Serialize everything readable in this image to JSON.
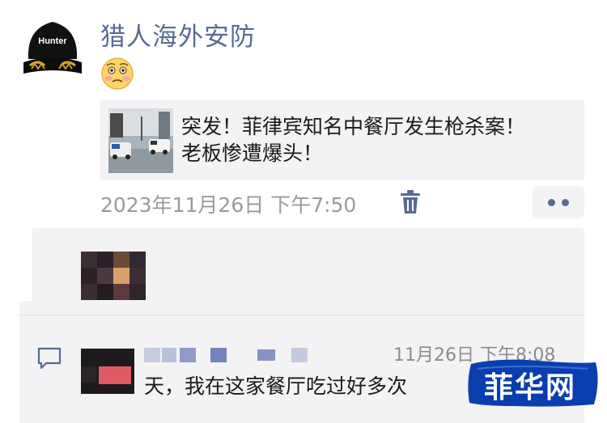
{
  "post": {
    "poster_name": "猎人海外安防",
    "avatar_text": "Hunter",
    "emoji": "woozy-face-emoji",
    "shared_article": {
      "title_line1": "突发！菲律宾知名中餐厅发生枪杀案！",
      "title_line2": "老板惨遭爆头！"
    },
    "timestamp": "2023年11月26日 下午7:50"
  },
  "comment": {
    "time": "11月26日 下午8:08",
    "text": "天，我在这家餐厅吃过好多次"
  },
  "watermark": {
    "text": "菲华网"
  },
  "colors": {
    "name_link": "#576b95",
    "timestamp": "#9a9a9a",
    "panel_bg": "#f3f3f5",
    "watermark_bg": "#0b3fb0"
  }
}
